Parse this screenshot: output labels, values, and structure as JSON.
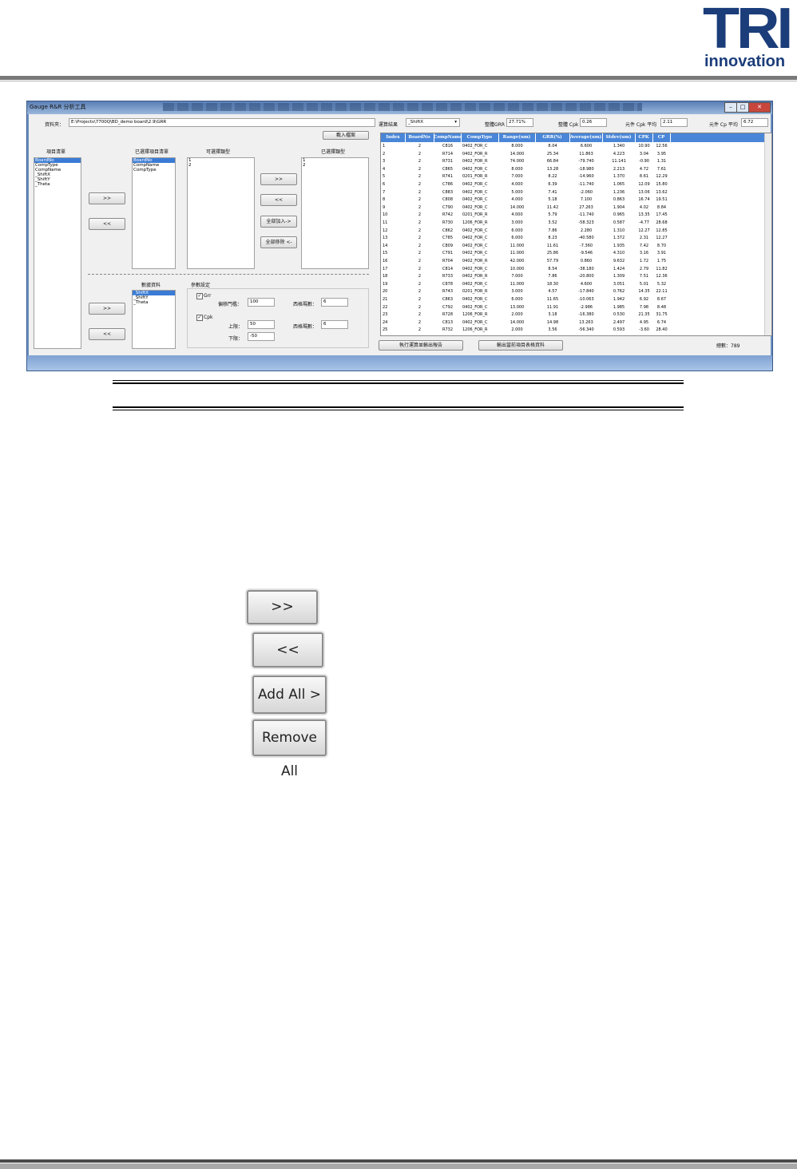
{
  "header": {
    "logo_main": "TRI",
    "logo_sub": "innovation"
  },
  "window": {
    "title": "Gauge R&R 分析工具",
    "folder_label": "資料夾：",
    "folder_path": "E:\\Projects\\7700Q\\BD_demo board\\2.9\\GRR",
    "load_button": "載入檔案",
    "items_list_label": "項目清單",
    "items_list": [
      "BoardNo",
      "CompType",
      "CompName",
      "_ShiftX",
      "_ShiftY",
      "_Theta"
    ],
    "selected_items_label": "已選擇項目清單",
    "selected_items": [
      "BoardNo",
      "CompName",
      "CompType"
    ],
    "available_types_label": "可選擇類型",
    "available_types": [
      "1",
      "2"
    ],
    "chosen_types_label": "已選擇類型",
    "chosen_types": [
      "1",
      "2"
    ],
    "btn_add": ">>",
    "btn_remove": "<<",
    "btn_add_all": "全部加入->",
    "btn_remove_all": "全部移除 <-",
    "data_label": "數據資料",
    "data_list": [
      "_ShiftX",
      "_ShiftY",
      "_Theta"
    ],
    "params_label": "參數設定",
    "grr_check": "Grr",
    "cpk_check": "Cpk",
    "tolerance_label": "偏移門檻：",
    "tolerance_value": "100",
    "upper_label": "上限：",
    "upper_value": "50",
    "lower_label": "下限：",
    "lower_value": "-50",
    "decimals_label": "西格瑪數：",
    "decimals_value_1": "6",
    "decimals_value_2": "6",
    "result_label": "運算結果",
    "result_select": "_ShiftX",
    "overall_grr_label": "整體GRR",
    "overall_grr_value": "27.71%",
    "overall_cpk_label": "整體 Cpk",
    "overall_cpk_value": "0.26",
    "avg_cpk_label": "元件 Cpk 平均",
    "avg_cpk_value": "2.11",
    "avg_cp_label": "元件 Cp 平均",
    "avg_cp_value": "6.72",
    "run_button": "執行運算並輸出報告",
    "export_button": "輸出當前項目表格資料",
    "count_text": "總數：789",
    "grid_headers": [
      "Index",
      "BoardNo",
      "CompName",
      "CompType",
      "Range(um)",
      "GRR(%)",
      "Average(um)",
      "Stdev(um)",
      "CPK",
      "CP"
    ],
    "grid_rows": [
      [
        "1",
        "2",
        "C816",
        "0402_FOR_C",
        "8.000",
        "8.04",
        "6.600",
        "1.340",
        "10.90",
        "12.56"
      ],
      [
        "2",
        "2",
        "R714",
        "0402_FOR_R",
        "14.000",
        "25.34",
        "11.863",
        "4.223",
        "3.04",
        "3.95"
      ],
      [
        "3",
        "2",
        "R731",
        "0402_FOR_R",
        "74.000",
        "66.84",
        "-79.740",
        "11.141",
        "-0.90",
        "1.31"
      ],
      [
        "4",
        "2",
        "C865",
        "0402_FOR_C",
        "8.000",
        "13.28",
        "-18.980",
        "2.213",
        "4.72",
        "7.61"
      ],
      [
        "5",
        "2",
        "R741",
        "0201_FOR_R",
        "7.000",
        "8.22",
        "-14.960",
        "1.370",
        "8.61",
        "12.29"
      ],
      [
        "6",
        "2",
        "C786",
        "0402_FOR_C",
        "4.000",
        "6.39",
        "-11.740",
        "1.065",
        "12.09",
        "15.80"
      ],
      [
        "7",
        "2",
        "C883",
        "0402_FOR_C",
        "5.000",
        "7.41",
        "-2.060",
        "1.236",
        "13.06",
        "13.62"
      ],
      [
        "8",
        "2",
        "C808",
        "0402_FOR_C",
        "4.000",
        "5.18",
        "7.100",
        "0.863",
        "16.74",
        "19.51"
      ],
      [
        "9",
        "2",
        "C790",
        "0402_FOR_C",
        "14.000",
        "11.42",
        "27.263",
        "1.904",
        "4.02",
        "8.84"
      ],
      [
        "10",
        "2",
        "R742",
        "0201_FOR_R",
        "4.000",
        "5.79",
        "-11.740",
        "0.965",
        "13.35",
        "17.45"
      ],
      [
        "11",
        "2",
        "R730",
        "1206_FOR_R",
        "3.000",
        "3.52",
        "-58.323",
        "0.587",
        "-4.77",
        "28.68"
      ],
      [
        "12",
        "2",
        "C862",
        "0402_FOR_C",
        "6.000",
        "7.86",
        "2.280",
        "1.310",
        "12.27",
        "12.85"
      ],
      [
        "13",
        "2",
        "C785",
        "0402_FOR_C",
        "6.000",
        "8.23",
        "-40.580",
        "1.372",
        "2.31",
        "12.27"
      ],
      [
        "14",
        "2",
        "C809",
        "0402_FOR_C",
        "11.000",
        "11.61",
        "-7.360",
        "1.935",
        "7.42",
        "8.70"
      ],
      [
        "15",
        "2",
        "C791",
        "0402_FOR_C",
        "11.000",
        "25.86",
        "-9.546",
        "4.310",
        "3.16",
        "3.91"
      ],
      [
        "16",
        "2",
        "R704",
        "0402_FOR_R",
        "42.000",
        "57.79",
        "0.860",
        "9.632",
        "1.72",
        "1.75"
      ],
      [
        "17",
        "2",
        "C814",
        "0402_FOR_C",
        "10.000",
        "8.54",
        "-38.180",
        "1.424",
        "2.79",
        "11.82"
      ],
      [
        "18",
        "2",
        "R733",
        "0402_FOR_R",
        "7.000",
        "7.86",
        "-20.800",
        "1.309",
        "7.51",
        "12.36"
      ],
      [
        "19",
        "2",
        "C878",
        "0402_FOR_C",
        "11.000",
        "18.30",
        "4.600",
        "3.051",
        "5.01",
        "5.32"
      ],
      [
        "20",
        "2",
        "R743",
        "0201_FOR_R",
        "3.000",
        "4.57",
        "-17.840",
        "0.762",
        "14.35",
        "22.11"
      ],
      [
        "21",
        "2",
        "C863",
        "0402_FOR_C",
        "6.000",
        "11.65",
        "-10.063",
        "1.942",
        "6.92",
        "8.67"
      ],
      [
        "22",
        "2",
        "C792",
        "0402_FOR_C",
        "13.000",
        "11.91",
        "-2.986",
        "1.985",
        "7.98",
        "8.48"
      ],
      [
        "23",
        "2",
        "R728",
        "1206_FOR_R",
        "2.000",
        "3.18",
        "-16.380",
        "0.530",
        "21.35",
        "31.75"
      ],
      [
        "24",
        "2",
        "C813",
        "0402_FOR_C",
        "14.000",
        "14.98",
        "13.263",
        "2.497",
        "4.95",
        "6.74"
      ],
      [
        "25",
        "2",
        "R732",
        "1206_FOR_R",
        "2.000",
        "3.56",
        "-56.340",
        "0.593",
        "-3.60",
        "28.40"
      ]
    ]
  },
  "enlarged_buttons": {
    "add": ">>",
    "remove": "<<",
    "add_all": "Add All >",
    "remove_all": "Remove All"
  }
}
